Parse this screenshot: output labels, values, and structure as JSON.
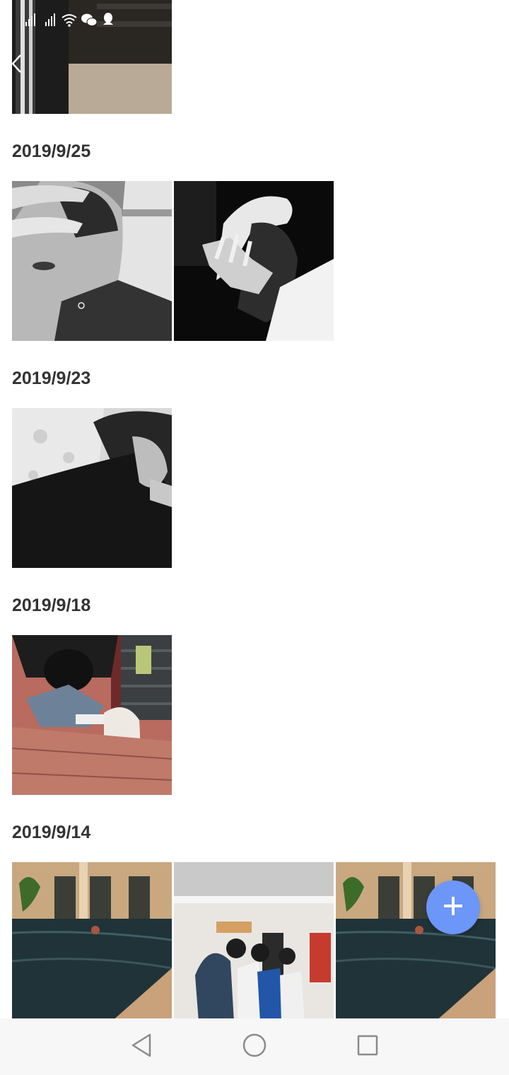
{
  "status_bar": {
    "icons": [
      "signal-3g-icon",
      "signal-3g-icon",
      "wifi-icon",
      "wechat-icon",
      "qq-icon"
    ]
  },
  "navigation": {
    "back_icon": "chevron-left-icon"
  },
  "date_groups": [
    {
      "date": "2019/9/25",
      "photo_count": 2
    },
    {
      "date": "2019/9/23",
      "photo_count": 1
    },
    {
      "date": "2019/9/18",
      "photo_count": 1
    },
    {
      "date": "2019/9/14",
      "photo_count": 3
    }
  ],
  "fab": {
    "icon": "plus-icon",
    "color": "#6c96f7"
  },
  "system_nav": {
    "icons": [
      "back-triangle-icon",
      "home-circle-icon",
      "recents-square-icon"
    ]
  }
}
